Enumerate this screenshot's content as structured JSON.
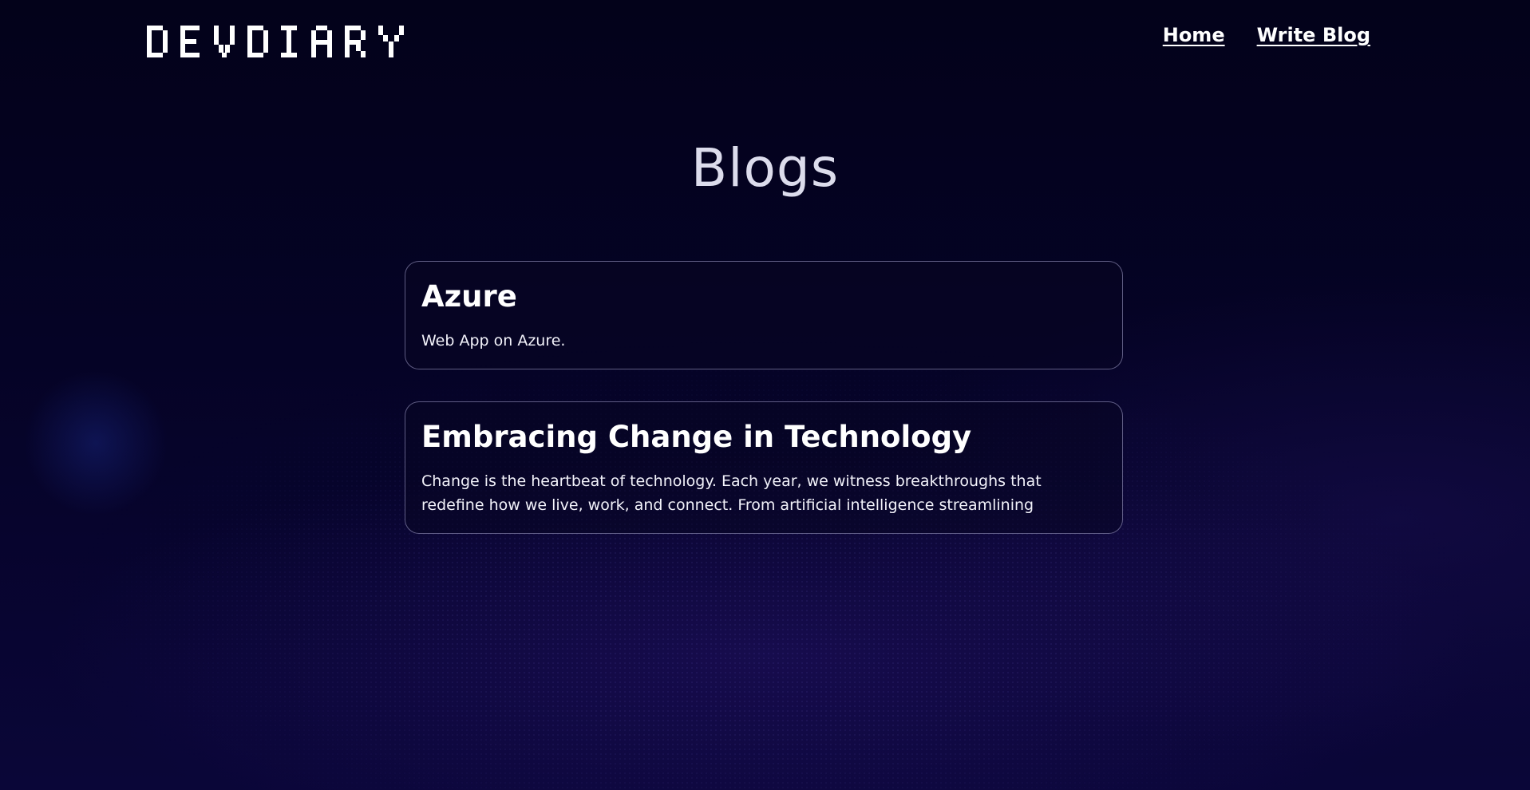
{
  "brand": {
    "logo_text": "DEVDIARY"
  },
  "nav": {
    "items": [
      {
        "label": "Home"
      },
      {
        "label": "Write Blog"
      }
    ]
  },
  "page": {
    "title": "Blogs"
  },
  "blogs": [
    {
      "title": "Azure",
      "excerpt": "Web App on Azure."
    },
    {
      "title": "Embracing Change in Technology",
      "excerpt": "Change is the heartbeat of technology. Each year, we witness breakthroughs that redefine how we live, work, and connect. From artificial intelligence streamlining"
    }
  ],
  "colors": {
    "background": "#050326",
    "text": "#ffffff",
    "title": "#dcdcec",
    "card_border": "#aaa5d2"
  }
}
